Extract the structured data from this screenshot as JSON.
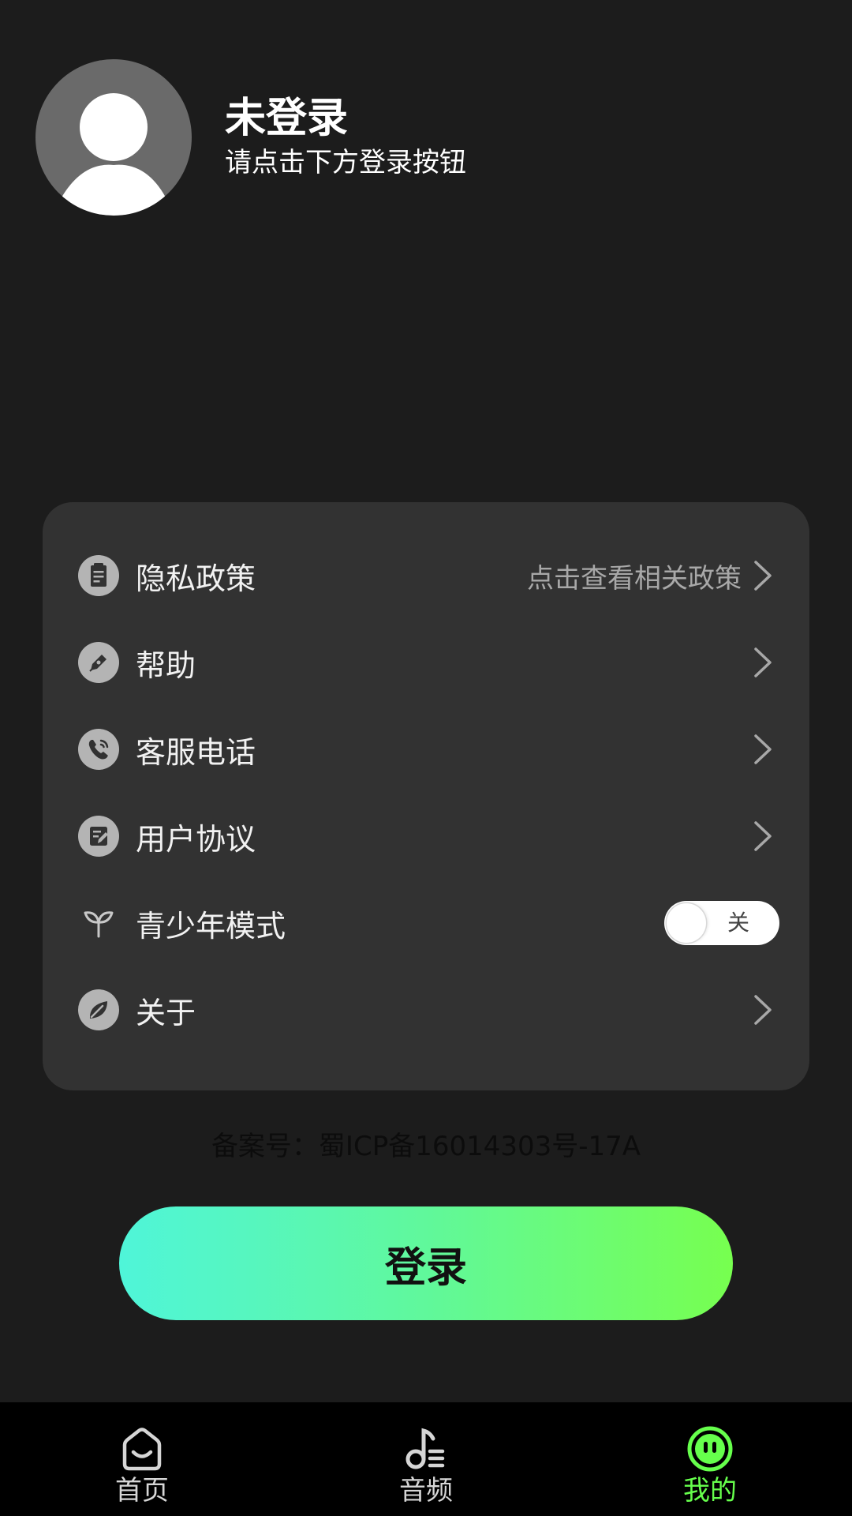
{
  "profile": {
    "title": "未登录",
    "subtitle": "请点击下方登录按钮"
  },
  "menu": {
    "privacy": {
      "label": "隐私政策",
      "hint": "点击查看相关政策",
      "icon": "clipboard-icon"
    },
    "help": {
      "label": "帮助",
      "icon": "pen-icon"
    },
    "service_phone": {
      "label": "客服电话",
      "icon": "phone-icon"
    },
    "user_agreement": {
      "label": "用户协议",
      "icon": "document-edit-icon"
    },
    "youth_mode": {
      "label": "青少年模式",
      "icon": "sprout-icon",
      "toggle_text": "关",
      "enabled": false
    },
    "about": {
      "label": "关于",
      "icon": "leaf-icon"
    }
  },
  "icp": "备案号：蜀ICP备16014303号-17A",
  "login_button": "登录",
  "tabs": [
    {
      "label": "首页",
      "icon": "home-icon",
      "active": false
    },
    {
      "label": "音频",
      "icon": "music-note-icon",
      "active": false
    },
    {
      "label": "我的",
      "icon": "smile-face-icon",
      "active": true
    }
  ],
  "colors": {
    "background": "#1c1c1c",
    "card": "#323232",
    "accent": "#66ff4c",
    "gradient_start": "#4ff5d9",
    "gradient_end": "#77ff4f"
  }
}
